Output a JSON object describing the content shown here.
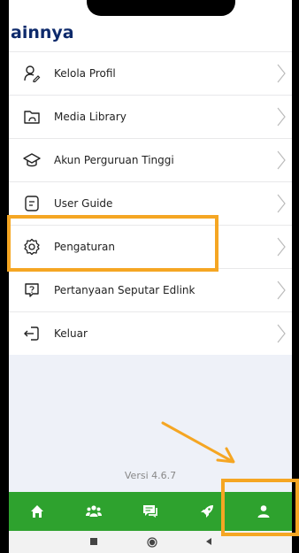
{
  "header": {
    "title": "ainnya"
  },
  "menu": {
    "items": [
      {
        "label": "Kelola Profil",
        "icon": "user-edit-icon"
      },
      {
        "label": "Media Library",
        "icon": "folder-icon"
      },
      {
        "label": "Akun Perguruan Tinggi",
        "icon": "graduation-cap-icon"
      },
      {
        "label": "User Guide",
        "icon": "document-icon"
      },
      {
        "label": "Pengaturan",
        "icon": "gear-icon"
      },
      {
        "label": "Pertanyaan Seputar Edlink",
        "icon": "question-bubble-icon"
      },
      {
        "label": "Keluar",
        "icon": "logout-icon"
      }
    ]
  },
  "version": "Versi 4.6.7",
  "bottom_nav": {
    "items": [
      "home-icon",
      "group-icon",
      "chat-icon",
      "rocket-icon",
      "profile-icon"
    ],
    "active": "profile-icon"
  },
  "colors": {
    "nav_green": "#2ea22e",
    "title_navy": "#0e2a6b",
    "annotation_orange": "#f5a623"
  }
}
